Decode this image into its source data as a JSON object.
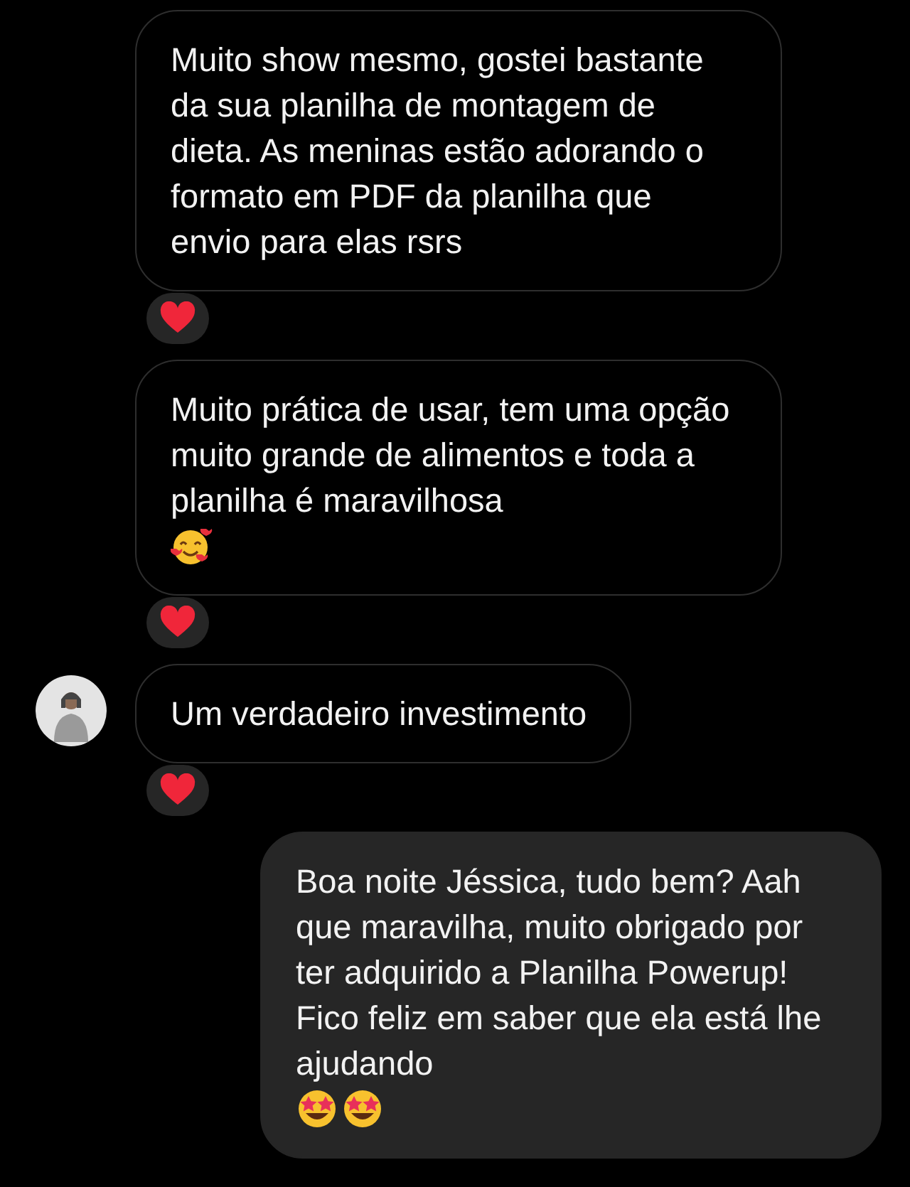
{
  "messages": [
    {
      "kind": "received",
      "text": "Muito show mesmo, gostei bastante da sua planilha de montagem de dieta. As meninas estão adorando o formato em PDF da planilha que envio para elas rsrs",
      "reaction": true
    },
    {
      "kind": "received",
      "text": "Muito prática de usar, tem uma opção muito grande de alimentos e toda a planilha é maravilhosa",
      "reaction": true,
      "emoji": [
        {
          "kind": "hearts"
        }
      ]
    },
    {
      "kind": "received",
      "text": "Um verdadeiro investimento",
      "avatar": true,
      "reaction": true
    },
    {
      "kind": "sent",
      "text": "Boa noite Jéssica, tudo bem? Aah que maravilha, muito obrigado por ter adquirido a Planilha Powerup! Fico feliz em saber que ela está lhe ajudando",
      "emoji": [
        {
          "kind": "star-eyes"
        },
        {
          "kind": "star-eyes"
        }
      ]
    }
  ]
}
